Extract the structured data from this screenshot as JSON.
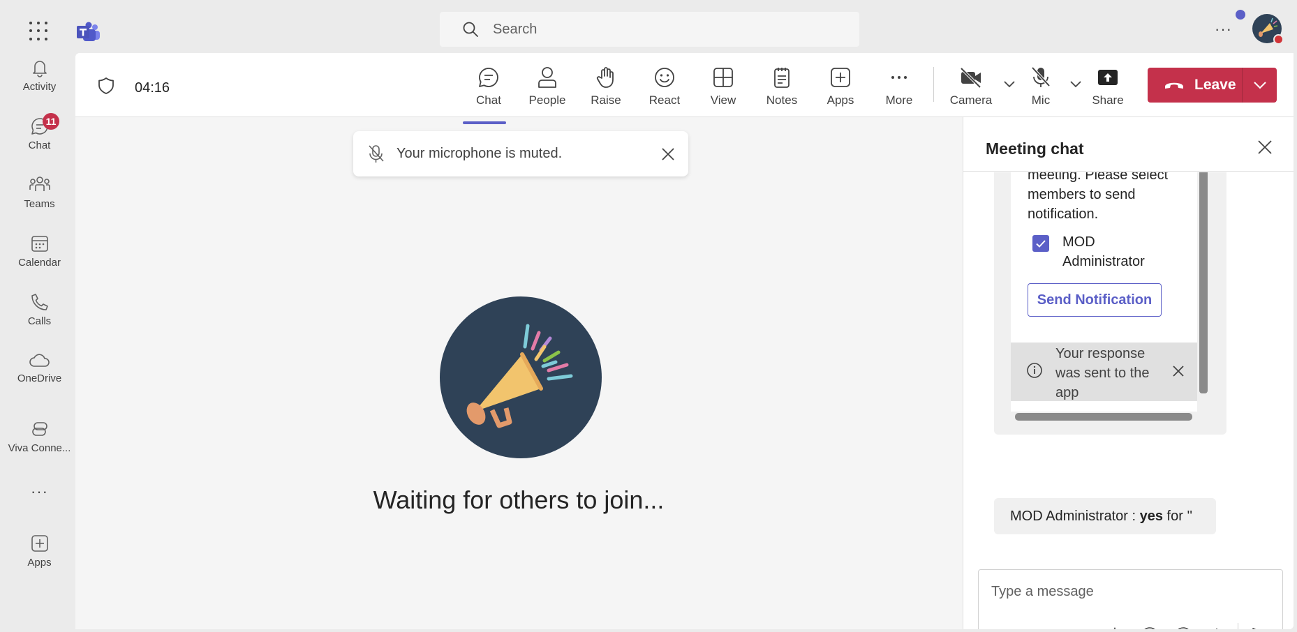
{
  "titlebar": {
    "search_placeholder": "Search",
    "more_label": "···",
    "icons": [
      "app-launcher-icon",
      "teams-logo-icon",
      "search-icon",
      "more-icon",
      "avatar"
    ]
  },
  "rail": {
    "items": [
      {
        "label": "Activity",
        "icon": "bell-icon"
      },
      {
        "label": "Chat",
        "icon": "chat-icon",
        "badge": "11"
      },
      {
        "label": "Teams",
        "icon": "teams-icon"
      },
      {
        "label": "Calendar",
        "icon": "calendar-icon"
      },
      {
        "label": "Calls",
        "icon": "phone-icon"
      },
      {
        "label": "OneDrive",
        "icon": "cloud-icon"
      },
      {
        "label": "Viva Conne...",
        "icon": "viva-connections-icon"
      },
      {
        "label": "Apps",
        "icon": "add-app-icon"
      }
    ],
    "more_label": "···"
  },
  "meeting": {
    "timer": "04:16",
    "tools": [
      {
        "label": "Chat",
        "icon": "chat-icon",
        "active": true
      },
      {
        "label": "People",
        "icon": "people-icon"
      },
      {
        "label": "Raise",
        "icon": "raise-hand-icon"
      },
      {
        "label": "React",
        "icon": "smiley-icon"
      },
      {
        "label": "View",
        "icon": "grid-view-icon"
      },
      {
        "label": "Notes",
        "icon": "notes-icon"
      },
      {
        "label": "Apps",
        "icon": "add-app-icon"
      },
      {
        "label": "More",
        "icon": "more-icon"
      },
      {
        "label": "Camera",
        "icon": "camera-off-icon"
      },
      {
        "label": "Mic",
        "icon": "mic-off-icon"
      },
      {
        "label": "Share",
        "icon": "share-icon"
      }
    ],
    "leave_label": "Leave",
    "toast_text": "Your microphone is muted.",
    "waiting_text": "Waiting for others to join...",
    "colors": {
      "accent": "#5b5fc7",
      "leave": "#c4314b",
      "hero_bg": "#2f4257"
    }
  },
  "chat_panel": {
    "title": "Meeting chat",
    "card": {
      "text": "meeting. Please select members to send notification.",
      "checkbox_label": "MOD Administrator",
      "checkbox_checked": true,
      "send_button": "Send Notification",
      "response_text": "Your response was sent to the app"
    },
    "reply": {
      "prefix": "MOD Administrator : ",
      "bold": "yes",
      "suffix": " for ''"
    },
    "composer_placeholder": "Type a message"
  }
}
